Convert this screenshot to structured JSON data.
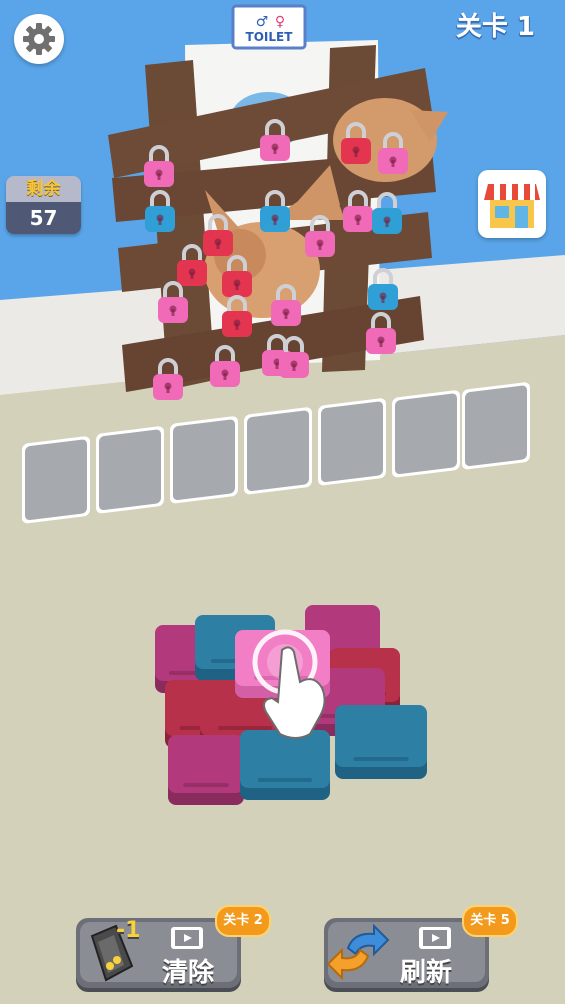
{
  "top": {
    "level_label": "关卡 1",
    "toilet_sign": "TOILET"
  },
  "remaining": {
    "label": "剩余",
    "count": "57"
  },
  "slots": {
    "count": 7
  },
  "bottom_buttons": [
    {
      "label": "清除",
      "cost_badge": "-1",
      "unlock_badge": "关卡 2",
      "icon": "magnet-icon"
    },
    {
      "label": "刷新",
      "unlock_badge": "关卡 5",
      "icon": "refresh-arrows-icon"
    }
  ],
  "colors": {
    "sky": "#5aa5e9",
    "floor": "#d4d1ba",
    "wall": "#eceae6",
    "wood": "#6b4a36",
    "lock_pink": "#f06ab8",
    "lock_red": "#e43550",
    "lock_blue": "#2f9fd6",
    "tile_magenta": "#b2397b",
    "tile_teal": "#2d7fa3",
    "tile_red": "#b7314b"
  }
}
